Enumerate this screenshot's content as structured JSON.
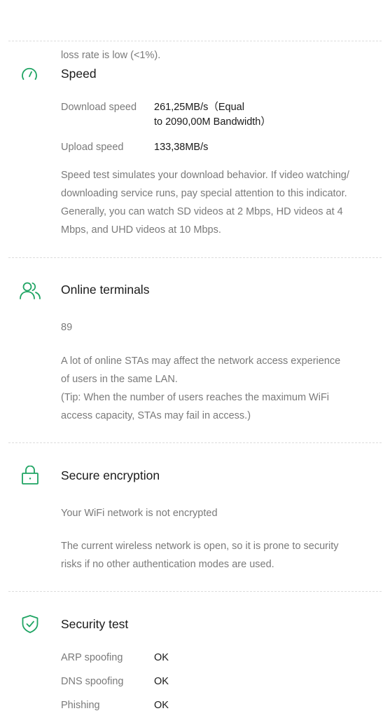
{
  "top_text": {
    "line1": "…",
    "line2": "loss rate is low (<1%)."
  },
  "accent_color": "#1fa463",
  "speed": {
    "icon": "speedometer-icon",
    "title": "Speed",
    "download_label": "Download speed",
    "download_value": "261,25MB/s（Equal\nto 2090,00M Bandwidth）",
    "upload_label": "Upload speed",
    "upload_value": "133,38MB/s",
    "description": "Speed test simulates your download behavior. If video watching/\ndownloading service runs, pay special attention to this indicator.\nGenerally, you can watch SD videos at 2 Mbps, HD videos at 4\nMbps, and UHD videos at 10 Mbps."
  },
  "terminals": {
    "icon": "users-icon",
    "title": "Online terminals",
    "count": "89",
    "description": "A lot of online STAs may affect the network access experience\nof users in the same LAN.\n(Tip: When the number of users reaches the maximum WiFi\naccess capacity, STAs may fail in access.)"
  },
  "encryption": {
    "icon": "lock-icon",
    "title": "Secure encryption",
    "status": "Your WiFi network is not encrypted",
    "description": "The current wireless network is open, so it is prone to security\nrisks if no other authentication modes are used."
  },
  "security": {
    "icon": "shield-check-icon",
    "title": "Security test",
    "rows": [
      {
        "label": "ARP spoofing",
        "value": "OK"
      },
      {
        "label": "DNS spoofing",
        "value": "OK"
      },
      {
        "label": "Phishing",
        "value": "OK"
      }
    ]
  }
}
